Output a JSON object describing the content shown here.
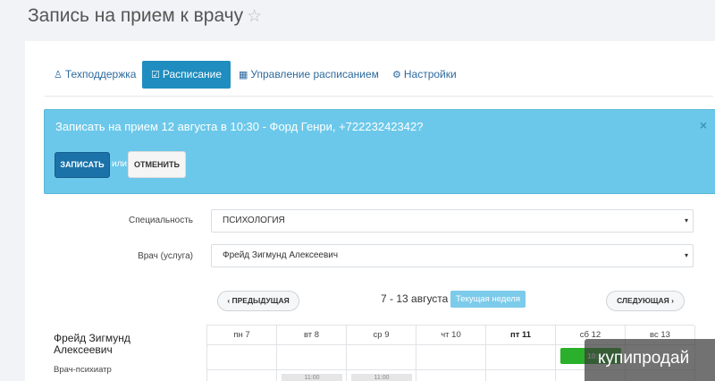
{
  "header": {
    "title": "Запись на прием к врачу",
    "star": "☆"
  },
  "tabs": [
    {
      "icon": "user-md-icon",
      "glyph": "♙",
      "label": "Техподдержка",
      "active": false
    },
    {
      "icon": "calendar-check-icon",
      "glyph": "☑",
      "label": "Расписание",
      "active": true
    },
    {
      "icon": "calendar-icon",
      "glyph": "▦",
      "label": "Управление расписанием",
      "active": false
    },
    {
      "icon": "gear-icon",
      "glyph": "⚙",
      "label": "Настройки",
      "active": false
    }
  ],
  "alert": {
    "text": "Записать на прием 12 августа в 10:30 - Форд Генри, +72223242342?",
    "close": "×",
    "confirm_label": "ЗАПИСАТЬ",
    "or_label": "или",
    "cancel_label": "ОТМЕНИТЬ"
  },
  "form": {
    "specialty_label": "Специальность",
    "specialty_value": "ПСИХОЛОГИЯ",
    "doctor_label": "Врач (услуга)",
    "doctor_value": "Фрейд Зигмунд Алексеевич",
    "caret": "▾"
  },
  "week_nav": {
    "prev_label": "‹  ПРЕДЫДУЩАЯ",
    "range": "7 - 13 августа",
    "current_badge": "Текущая неделя",
    "next_label": "СЛЕДУЮЩАЯ  ›"
  },
  "doctor": {
    "name": "Фрейд Зигмунд Алексеевич",
    "specialty": "Врач-психиатр"
  },
  "days": [
    {
      "label": "пн  7",
      "bold": false
    },
    {
      "label": "вт  8",
      "bold": false
    },
    {
      "label": "ср  9",
      "bold": false
    },
    {
      "label": "чт  10",
      "bold": false
    },
    {
      "label": "пт  11",
      "bold": true
    },
    {
      "label": "сб  12",
      "bold": false
    },
    {
      "label": "вс  13",
      "bold": false
    }
  ],
  "slots": {
    "sat_selected": "10:",
    "tue_slot": "11:00",
    "wed_slot": "11:00"
  },
  "watermark": {
    "text": "купипродай"
  },
  "colors": {
    "accent": "#1f8dbf",
    "alert_bg": "#6cc8ea",
    "confirm": "#1b72a8",
    "slot_green": "#2ab02a"
  }
}
